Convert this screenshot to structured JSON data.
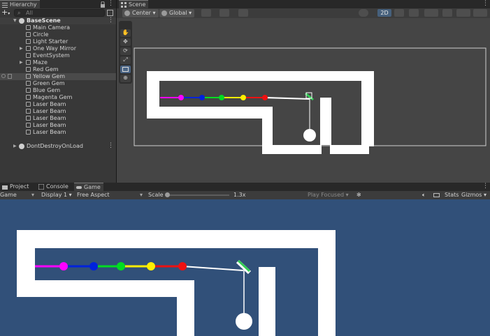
{
  "hierarchy": {
    "tab": "Hierarchy",
    "add": "+",
    "search_placeholder": "All",
    "scene_name": "BaseScene",
    "items": [
      {
        "label": "Main Camera"
      },
      {
        "label": "Circle"
      },
      {
        "label": "Light Starter"
      },
      {
        "label": "One Way Mirror"
      },
      {
        "label": "EventSystem"
      },
      {
        "label": "Maze"
      },
      {
        "label": "Red Gem"
      },
      {
        "label": "Yellow Gem"
      },
      {
        "label": "Green Gem"
      },
      {
        "label": "Blue Gem"
      },
      {
        "label": "Magenta Gem"
      },
      {
        "label": "Laser Beam"
      },
      {
        "label": "Laser Beam"
      },
      {
        "label": "Laser Beam"
      },
      {
        "label": "Laser Beam"
      },
      {
        "label": "Laser Beam"
      }
    ],
    "dont_destroy": "DontDestroyOnLoad"
  },
  "scene": {
    "tab": "Scene",
    "pivot": "Center",
    "space": "Global",
    "mode_2d": "2D"
  },
  "bottom_tabs": {
    "project": "Project",
    "console": "Console",
    "game": "Game"
  },
  "game_toolbar": {
    "view": "Game",
    "display": "Display 1",
    "aspect": "Free Aspect",
    "scale_label": "Scale",
    "scale_value": "1.3x",
    "play_mode": "Play Focused",
    "stats": "Stats",
    "gizmos": "Gizmos"
  },
  "icons": [
    "hand-tool-icon",
    "move-tool-icon",
    "rotate-tool-icon",
    "scale-tool-icon",
    "rect-tool-icon",
    "transform-tool-icon",
    "lock-icon",
    "kebab-menu-icon",
    "audio-icon",
    "bug-icon",
    "light-icon",
    "eye-icon",
    "gizmo-icon"
  ],
  "colors": {
    "game_background": "#315079",
    "maze": "#ffffff",
    "magenta": "#ff00ff",
    "blue": "#0022dd",
    "green": "#00dd22",
    "yellow": "#ffee00",
    "red": "#ee1111",
    "mirror": "#33cc55"
  }
}
